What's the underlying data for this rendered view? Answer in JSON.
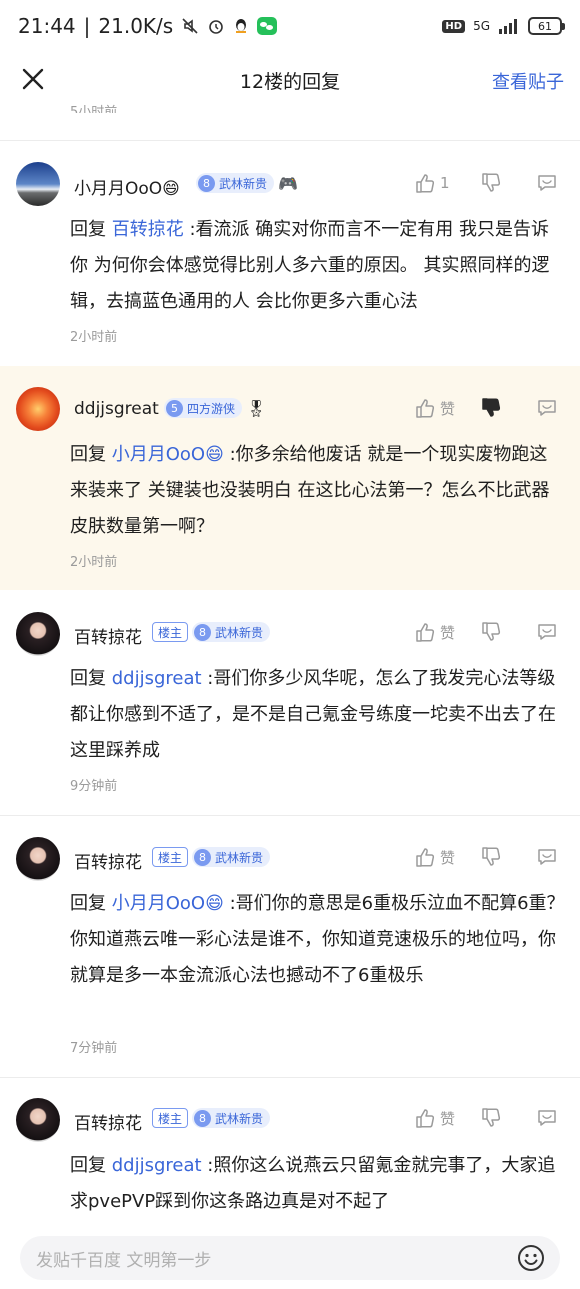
{
  "status_bar": {
    "time": "21:44",
    "separator": "|",
    "speed": "21.0K/s",
    "network": "5G",
    "hd": "HD",
    "battery": "61"
  },
  "header": {
    "title": "12楼的回复",
    "view_post": "查看贴子"
  },
  "prev_time": "5小时前",
  "replies": [
    {
      "username": "小月月OoO😄",
      "level": "8",
      "title_badge": "武林新贵",
      "extra_icon": "🎮",
      "like_label": "1",
      "prefix": "回复",
      "mention": "百转掠花",
      "text": ":看流派 确实对你而言不一定有用 我只是告诉你 为何你会体感觉得比别人多六重的原因。 其实照同样的逻辑，去搞蓝色通用的人 会比你更多六重心法",
      "time": "2小时前"
    },
    {
      "username": "ddjjsgreat",
      "level": "5",
      "title_badge": "四方游侠",
      "extra_icon": "🎖",
      "like_label": "赞",
      "prefix": "回复",
      "mention": "小月月OoO😄",
      "text": ":你多余给他废话 就是一个现实废物跑这来装来了 关键装也没装明白 在这比心法第一？怎么不比武器皮肤数量第一啊？",
      "time": "2小时前"
    },
    {
      "username": "百转掠花",
      "lou_badge": "楼主",
      "level": "8",
      "title_badge": "武林新贵",
      "like_label": "赞",
      "prefix": "回复",
      "mention": "ddjjsgreat",
      "text": ":哥们你多少风华呢，怎么了我发完心法等级都让你感到不适了，是不是自己氪金号练度一坨卖不出去了在这里踩养成",
      "time": "9分钟前"
    },
    {
      "username": "百转掠花",
      "lou_badge": "楼主",
      "level": "8",
      "title_badge": "武林新贵",
      "like_label": "赞",
      "prefix": "回复",
      "mention": "小月月OoO😄",
      "text": ":哥们你的意思是6重极乐泣血不配算6重？你知道燕云唯一彩心法是谁不，你知道竞速极乐的地位吗，你就算是多一本金流派心法也撼动不了6重极乐",
      "time": "7分钟前"
    },
    {
      "username": "百转掠花",
      "lou_badge": "楼主",
      "level": "8",
      "title_badge": "武林新贵",
      "like_label": "赞",
      "prefix": "回复",
      "mention": "ddjjsgreat",
      "text": ":照你这么说燕云只留氪金就完事了，大家追求pvePVP踩到你这条路边真是对不起了",
      "time": ""
    }
  ],
  "input": {
    "placeholder": "发贴千百度 文明第一步"
  },
  "colors": {
    "accent": "#3a66d8",
    "highlight_bg": "#fdf8ec",
    "muted": "#9b9b9b"
  }
}
